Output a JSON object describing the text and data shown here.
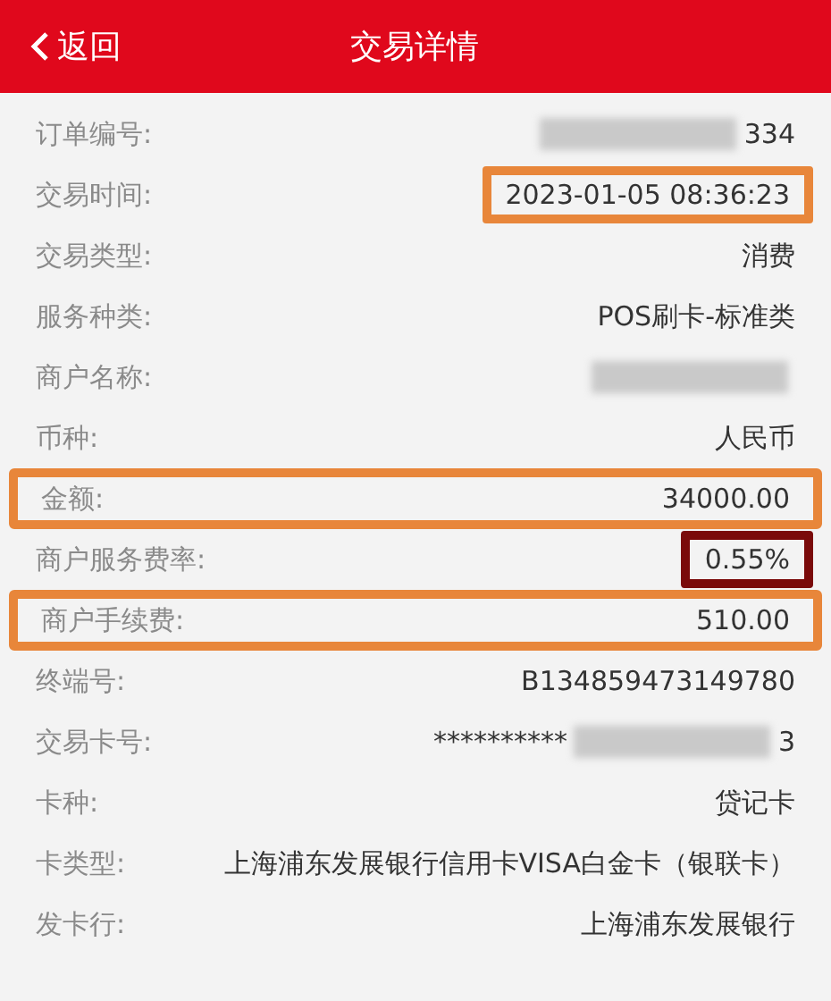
{
  "header": {
    "back": "返回",
    "title": "交易详情"
  },
  "rows": [
    {
      "label": "订单编号:",
      "value": "334",
      "redacted": true
    },
    {
      "label": "交易时间:",
      "value": "2023-01-05 08:36:23",
      "highlight": {
        "kind": "value",
        "color": "#e8863a"
      }
    },
    {
      "label": "交易类型:",
      "value": "消费"
    },
    {
      "label": "服务种类:",
      "value": "POS刷卡-标准类"
    },
    {
      "label": "商户名称:",
      "value": "",
      "redacted": true
    },
    {
      "label": "币种:",
      "value": "人民币"
    },
    {
      "label": "金额:",
      "value": "34000.00",
      "highlight": {
        "kind": "row",
        "color": "#e8863a"
      }
    },
    {
      "label": "商户服务费率:",
      "value": "0.55%",
      "highlight": {
        "kind": "value",
        "color": "#7a0a0a"
      }
    },
    {
      "label": "商户手续费:",
      "value": "510.00",
      "highlight": {
        "kind": "row",
        "color": "#e8863a"
      }
    },
    {
      "label": "终端号:",
      "value": "B134859473149780"
    },
    {
      "label": "交易卡号:",
      "value": "**********",
      "redacted": true,
      "suffix": "3"
    },
    {
      "label": "卡种:",
      "value": "贷记卡"
    },
    {
      "label": "卡类型:",
      "value": "上海浦东发展银行信用卡VISA白金卡（银联卡）"
    },
    {
      "label": "发卡行:",
      "value": "上海浦东发展银行"
    }
  ]
}
